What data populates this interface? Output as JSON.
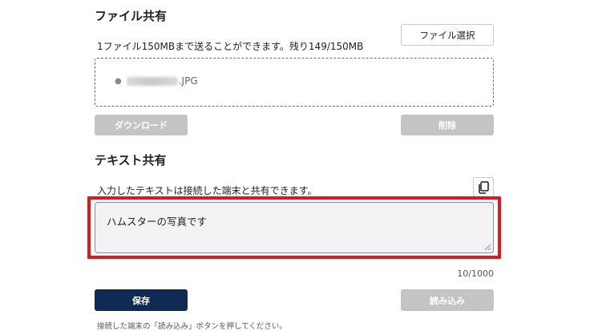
{
  "file_share": {
    "title": "ファイル共有",
    "description": "1ファイル150MBまで送ることができます。残り149/150MB",
    "select_button": "ファイル選択",
    "files": [
      {
        "name_suffix": ".JPG",
        "name_hidden": true
      }
    ],
    "download_button": "ダウンロード",
    "delete_button": "削除"
  },
  "text_share": {
    "title": "テキスト共有",
    "description": "入力したテキストは接続した端末と共有できます。",
    "copy_icon": "copy-icon",
    "input_value": "ハムスターの写真です",
    "counter": "10/1000",
    "save_button": "保存",
    "load_button": "読み込み",
    "footnote": "接続した端末の「読み込み」ボタンを押してください。"
  },
  "colors": {
    "primary": "#0e2a52",
    "disabled": "#c4c4c4",
    "highlight": "#e8141c",
    "input_border": "#6b93c8"
  }
}
